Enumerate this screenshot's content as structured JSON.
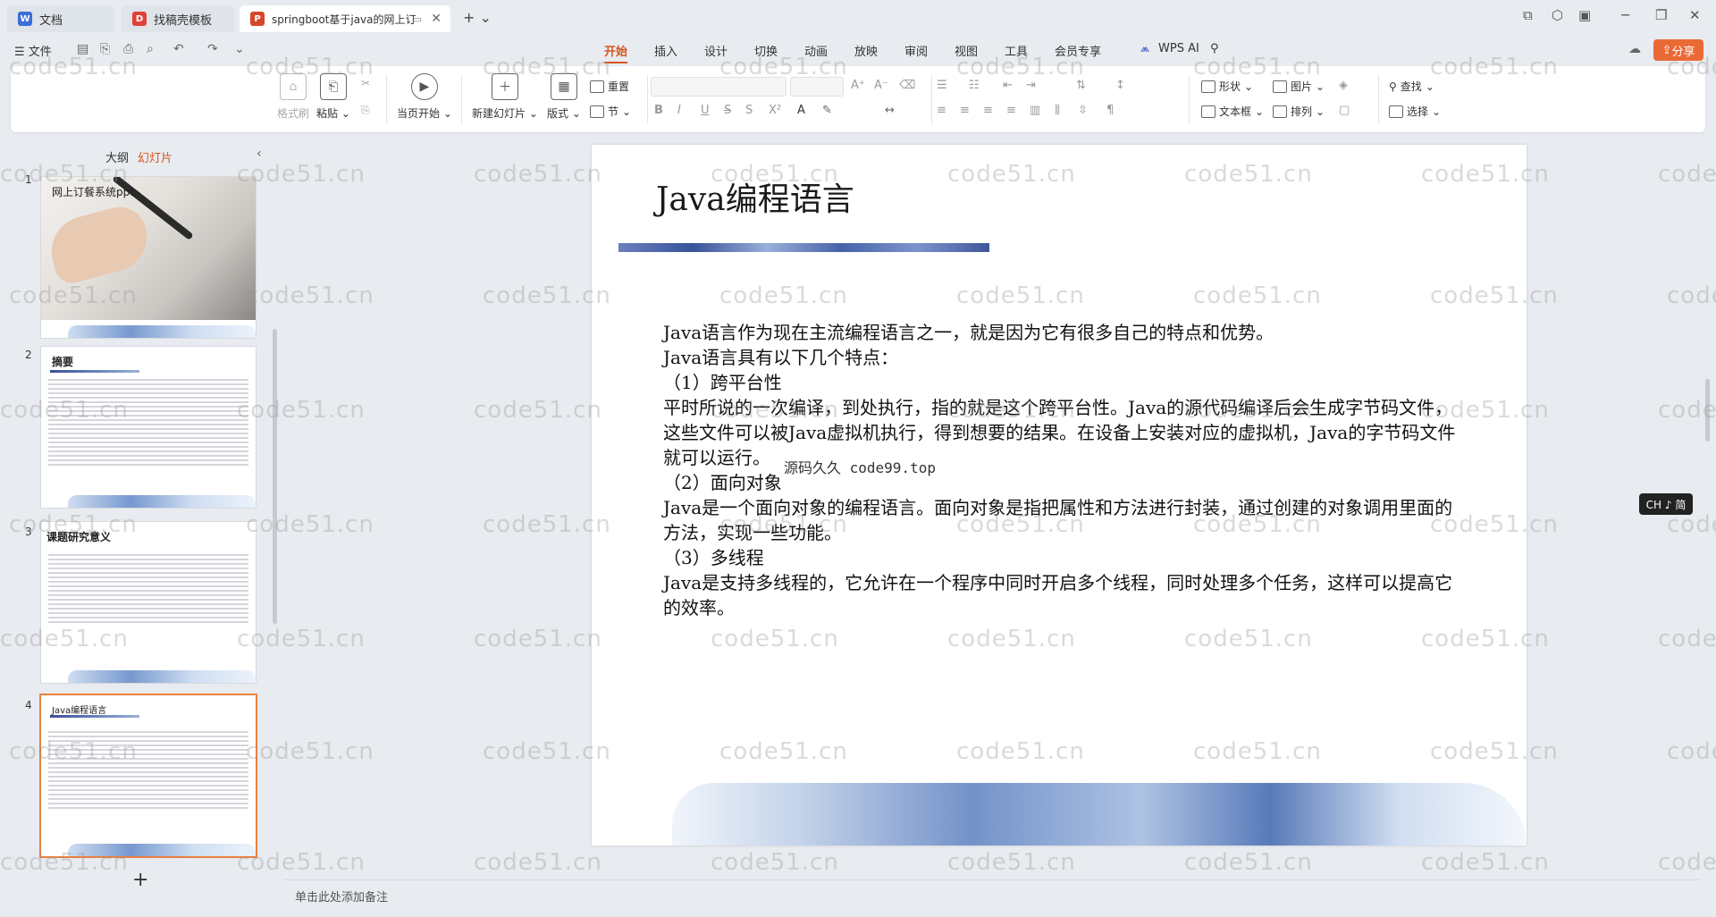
{
  "tabs": [
    {
      "label": "文档",
      "icon": "W",
      "color": "#3b6fd8"
    },
    {
      "label": "找稿壳模板",
      "icon": "D",
      "color": "#e0413a"
    },
    {
      "label": "springboot基于java的网上订",
      "icon": "P",
      "color": "#d7462c"
    }
  ],
  "tabbar": {
    "new_tab": "+ ⌄"
  },
  "ribbon_head": {
    "file_label": "☰ 文件",
    "tabs": [
      "开始",
      "插入",
      "设计",
      "切换",
      "动画",
      "放映",
      "审阅",
      "视图",
      "工具",
      "会员专享"
    ],
    "active_tab": "开始",
    "wps_ai": "WPS AI",
    "share": "分享"
  },
  "ribbon": {
    "format_painter": "格式刷",
    "paste": "粘贴",
    "start_from_current": "当页开始",
    "new_slide": "新建幻灯片",
    "layout": "版式",
    "reset": "重置",
    "section": "节",
    "shape": "形状",
    "picture": "图片",
    "textbox": "文本框",
    "arrange": "排列",
    "find": "查找",
    "select": "选择"
  },
  "left_panel": {
    "outline": "大纲",
    "slides": "幻灯片",
    "thumbnails": [
      {
        "num": "1",
        "title": "网上订餐系统ppt"
      },
      {
        "num": "2",
        "title": "摘要"
      },
      {
        "num": "3",
        "title": "课题研究意义"
      },
      {
        "num": "4",
        "title": "Java编程语言"
      }
    ],
    "add": "+"
  },
  "slide": {
    "title": "Java编程语言",
    "lines": [
      " Java语言作为现在主流编程语言之一，就是因为它有很多自己的特点和优势。",
      "Java语言具有以下几个特点：",
      "（1）跨平台性",
      "平时所说的一次编译，到处执行，指的就是这个跨平台性。Java的源代码编译后会生成字节码文件，这些文件可以被Java虚拟机执行，得到想要的结果。在设备上安装对应的虚拟机，Java的字节码文件就可以运行。",
      "（2）面向对象",
      "Java是一个面向对象的编程语言。面向对象是指把属性和方法进行封装，通过创建的对象调用里面的方法，实现一些功能。",
      "（3）多线程",
      "Java是支持多线程的，它允许在一个程序中同时开启多个线程，同时处理多个任务，这样可以提高它的效率。"
    ],
    "overlay_watermark": "源码久久 code99.top"
  },
  "ime_badge": "CH ♪ 简",
  "notes_placeholder": "单击此处添加备注",
  "watermark_text": "code51.cn"
}
